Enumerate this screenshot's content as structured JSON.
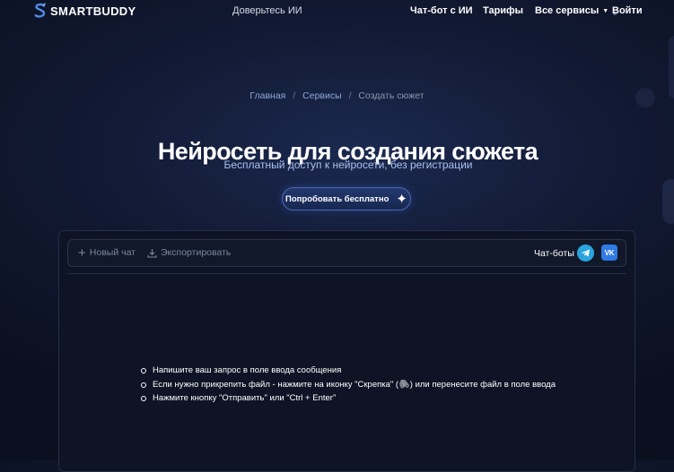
{
  "header": {
    "logo_text": "SMARTBUDDY",
    "tagline": "Доверьтесь ИИ",
    "nav": {
      "chat": "Чат-бот с ИИ",
      "tariffs": "Тарифы",
      "services": "Все сервисы",
      "login": "Войти"
    }
  },
  "breadcrumb": {
    "items": [
      "Главная",
      "Сервисы"
    ],
    "current": "Создать сюжет",
    "separator": "/"
  },
  "hero": {
    "title": "Нейросеть для создания сюжета",
    "subtitle": "Бесплатный доступ к нейросети, без регистрации",
    "cta_label": "Попробовать бесплатно"
  },
  "chat": {
    "toolbar": {
      "new_chat": "Новый чат",
      "export": "Экспортировать",
      "bots_label": "Чат-боты"
    },
    "hints": {
      "line1": "Напишите ваш запрос в поле ввода сообщения",
      "line2_before": "Если нужно прикрепить файл - нажмите на иконку \"Скрепка\" (",
      "clip_glyph": "🖇",
      "line2_after": ") или перенесите файл в поле ввода",
      "line3": "Нажмите кнопку \"Отправить\" или \"Ctrl + Enter\""
    }
  },
  "icons": {
    "logo": "logo-s-icon",
    "services_caret": "chevron-down-icon",
    "cta": "sparkle-icon",
    "new_chat": "plus-icon",
    "export": "download-icon",
    "telegram": "telegram-icon",
    "vk": "vk-icon"
  },
  "colors": {
    "background": "#0b1020",
    "accent_blue": "#2f7ae5",
    "telegram": "#2aa3df",
    "link": "#8fa6d6",
    "subtitle": "#a9c2ee"
  }
}
